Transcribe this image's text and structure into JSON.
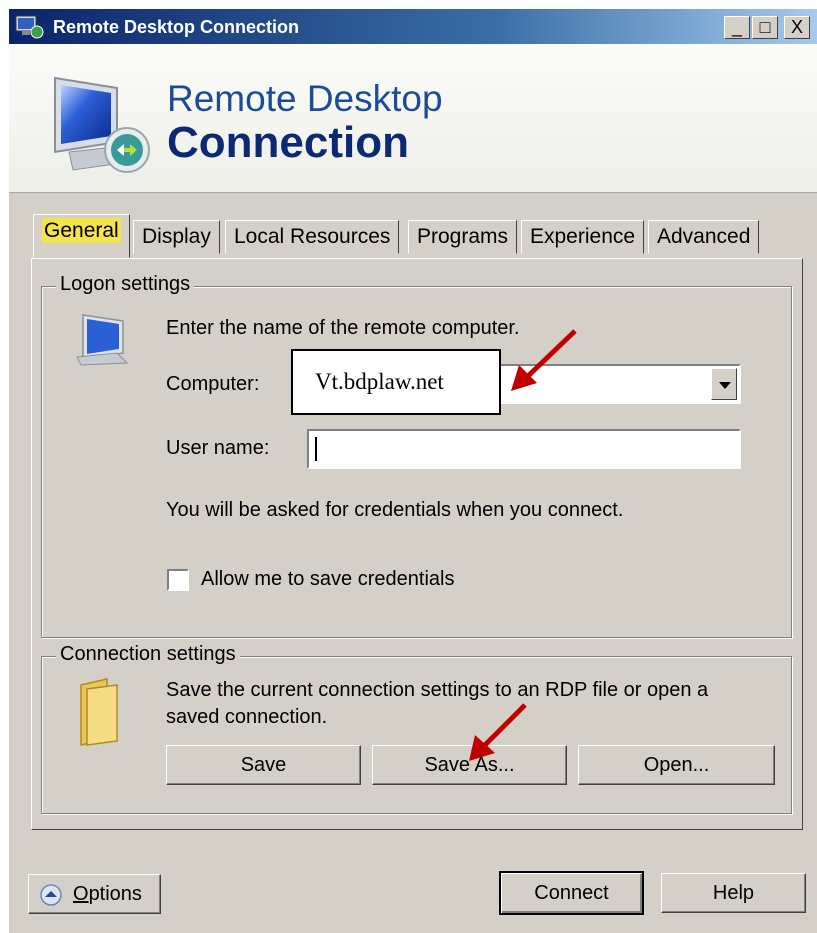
{
  "window": {
    "title": "Remote Desktop Connection",
    "controls": {
      "minimize": "_",
      "maximize": "□",
      "close": "X"
    }
  },
  "banner": {
    "line1": "Remote Desktop",
    "line2": "Connection"
  },
  "tabs": [
    {
      "label": "General",
      "active": true
    },
    {
      "label": "Display"
    },
    {
      "label": "Local Resources"
    },
    {
      "label": "Programs"
    },
    {
      "label": "Experience"
    },
    {
      "label": "Advanced"
    }
  ],
  "logon": {
    "group_label": "Logon settings",
    "instruction": "Enter the name of the remote computer.",
    "computer_label": "Computer:",
    "computer_value": "Vt.bdplaw.net",
    "username_label": "User name:",
    "username_value": "",
    "credentials_note": "You will be asked for credentials when you connect.",
    "save_credentials_label": "Allow me to save credentials",
    "save_credentials_checked": false
  },
  "connection": {
    "group_label": "Connection settings",
    "description_line1": "Save the current connection settings to an RDP file or open a",
    "description_line2": "saved connection.",
    "save_label": "Save",
    "save_as_label": "Save As...",
    "open_label": "Open..."
  },
  "footer": {
    "options_label_u": "O",
    "options_label_rest": "ptions",
    "connect_label": "Connect",
    "help_label": "Help"
  },
  "colors": {
    "tab_highlight": "#f2e44a",
    "annotation_arrow": "#c00000",
    "titlebar": "#0a246a"
  }
}
